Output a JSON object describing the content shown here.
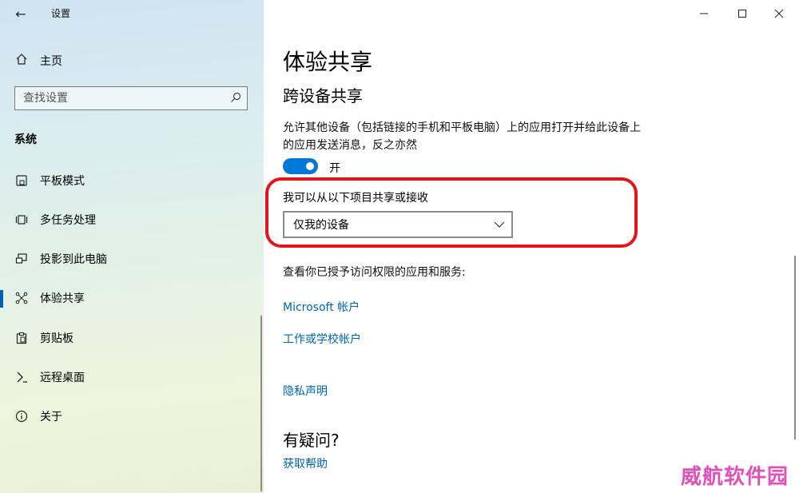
{
  "window": {
    "title": "设置",
    "controls": [
      "minimize-icon",
      "maximize-icon",
      "close-icon"
    ]
  },
  "sidebar": {
    "home_label": "主页",
    "search_placeholder": "查找设置",
    "section_label": "系统",
    "items": [
      {
        "label": "平板模式",
        "icon": "tablet-mode-icon",
        "active": false
      },
      {
        "label": "多任务处理",
        "icon": "multitasking-icon",
        "active": false
      },
      {
        "label": "投影到此电脑",
        "icon": "projecting-icon",
        "active": false
      },
      {
        "label": "体验共享",
        "icon": "shared-experiences-icon",
        "active": true
      },
      {
        "label": "剪贴板",
        "icon": "clipboard-icon",
        "active": false
      },
      {
        "label": "远程桌面",
        "icon": "remote-desktop-icon",
        "active": false
      },
      {
        "label": "关于",
        "icon": "info-icon",
        "active": false
      }
    ]
  },
  "main": {
    "title": "体验共享",
    "subheading": "跨设备共享",
    "description": "允许其他设备（包括链接的手机和平板电脑）上的应用打开并给此设备上的应用发送消息，反之亦然",
    "toggle": {
      "state": "on",
      "label": "开"
    },
    "share_label": "我可以从以下项目共享或接收",
    "dropdown_value": "仅我的设备",
    "access_text": "查看你已授予访问权限的应用和服务:",
    "links": {
      "microsoft_account": "Microsoft 帐户",
      "work_school_account": "工作或学校帐户",
      "privacy": "隐私声明"
    },
    "help_heading": "有疑问?",
    "help_link": "获取帮助"
  },
  "watermark": "威航软件园",
  "colors": {
    "accent": "#0078d7",
    "link": "#0063b1",
    "highlight_ring": "#e3141b",
    "watermark": "#e24fb8"
  }
}
